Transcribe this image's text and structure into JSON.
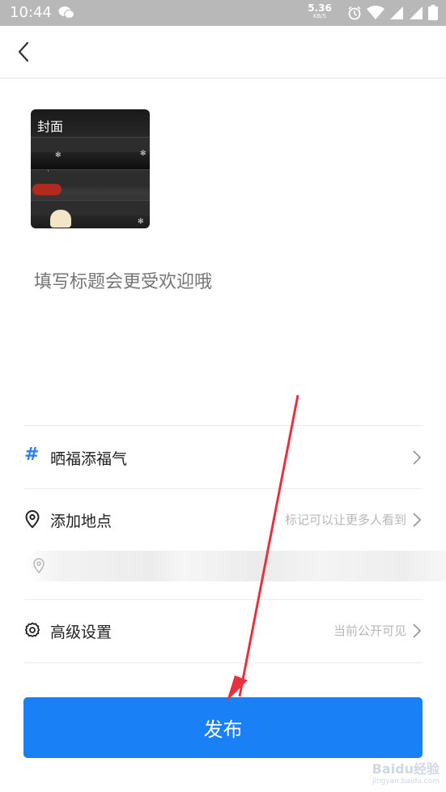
{
  "status_bar": {
    "time": "10:44",
    "net_speed_value": "5.36",
    "net_speed_unit": "KB/S",
    "icons": [
      "wechat-icon",
      "alarm-icon",
      "wifi-icon",
      "signal-icon",
      "signal-icon",
      "battery-icon"
    ]
  },
  "cover": {
    "label": "封面"
  },
  "title": {
    "placeholder": "填写标题会更受欢迎哦"
  },
  "topic_row": {
    "icon": "hash-icon",
    "label": "晒福添福气"
  },
  "location_row": {
    "icon": "location-pin-icon",
    "label": "添加地点",
    "hint": "标记可以让更多人看到"
  },
  "advanced_row": {
    "icon": "gear-icon",
    "label": "高级设置",
    "hint": "当前公开可见"
  },
  "publish_button": {
    "label": "发布"
  },
  "watermark": {
    "brand": "Baidu经验",
    "url": "jingyan.baidu.com"
  },
  "colors": {
    "accent": "#1a80f5",
    "annotation_arrow": "#e8303f",
    "topic_hash": "#2b7ff0"
  }
}
